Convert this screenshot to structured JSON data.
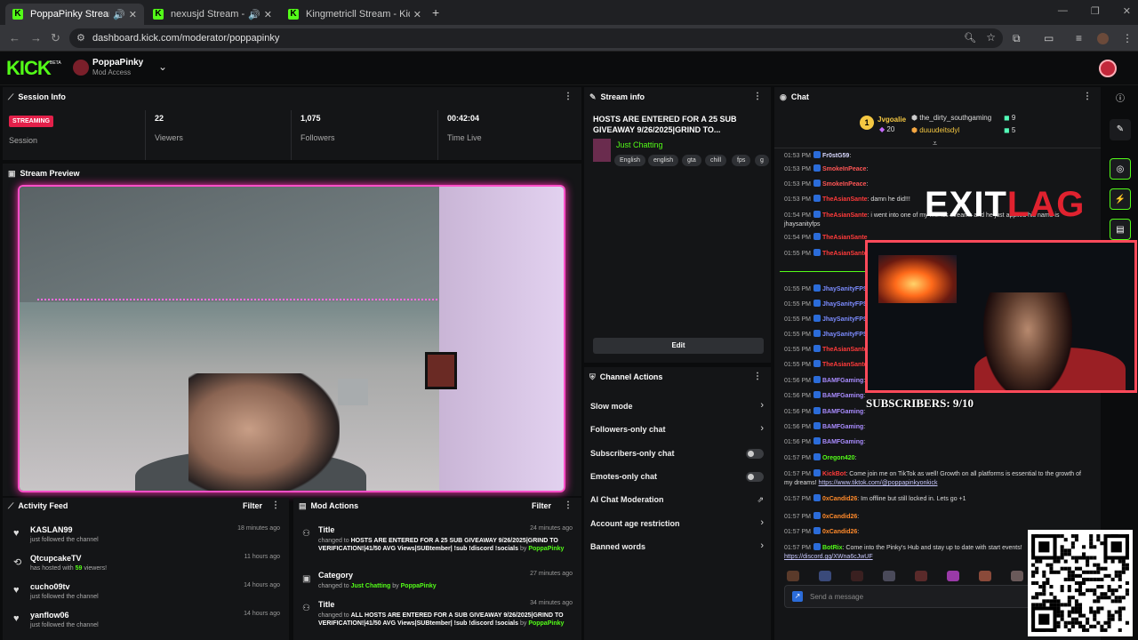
{
  "browser": {
    "tabs": [
      {
        "title": "PoppaPinky Stream - Kick D",
        "active": true
      },
      {
        "title": "nexusjd Stream - Kick Dash",
        "active": false
      },
      {
        "title": "Kingmetricll Stream - Kick Dash",
        "active": false
      }
    ],
    "url": "dashboard.kick.com/moderator/poppapinky"
  },
  "header": {
    "logo": "KICK",
    "logo_badge": "BETA",
    "channel_name": "PoppaPinky",
    "channel_role": "Mod Access"
  },
  "session": {
    "title": "Session Info",
    "badge": "STREAMING",
    "session_label": "Session",
    "viewers": "22",
    "viewers_label": "Viewers",
    "followers": "1,075",
    "followers_label": "Followers",
    "time_live": "00:42:04",
    "time_live_label": "Time Live"
  },
  "preview": {
    "title": "Stream Preview"
  },
  "stream_info": {
    "title": "Stream info",
    "stream_title": "HOSTS ARE ENTERED FOR A 25 SUB GIVEAWAY 9/26/2025|GRIND TO...",
    "category": "Just Chatting",
    "tags": [
      "English",
      "english",
      "gta",
      "chill",
      "fps",
      "g"
    ],
    "edit_label": "Edit"
  },
  "channel_actions": {
    "title": "Channel Actions",
    "items": [
      {
        "label": "Slow mode",
        "control": "chevron"
      },
      {
        "label": "Followers-only chat",
        "control": "chevron"
      },
      {
        "label": "Subscribers-only chat",
        "control": "toggle"
      },
      {
        "label": "Emotes-only chat",
        "control": "toggle"
      },
      {
        "label": "AI Chat Moderation",
        "control": "external"
      },
      {
        "label": "Account age restriction",
        "control": "chevron"
      },
      {
        "label": "Banned words",
        "control": "chevron"
      }
    ]
  },
  "activity": {
    "title": "Activity Feed",
    "filter_label": "Filter",
    "items": [
      {
        "name": "KASLAN99",
        "desc": "just followed the channel",
        "time": "18 minutes ago",
        "icon": "heart-icon"
      },
      {
        "name": "QtcupcakeTV",
        "desc_pre": "has hosted with ",
        "desc_count": "59",
        "desc_post": " viewers!",
        "time": "11 hours ago",
        "icon": "host-icon"
      },
      {
        "name": "cucho09tv",
        "desc": "just followed the channel",
        "time": "14 hours ago",
        "icon": "heart-icon"
      },
      {
        "name": "yanflow06",
        "desc": "just followed the channel",
        "time": "14 hours ago",
        "icon": "heart-icon"
      }
    ]
  },
  "mod_actions": {
    "title": "Mod Actions",
    "filter_label": "Filter",
    "items": [
      {
        "title": "Title",
        "time": "24 minutes ago",
        "pre": "changed to ",
        "value": "HOSTS ARE ENTERED FOR A 25 SUB GIVEAWAY 9/26/2025|GRIND TO VERIFICATION!|41/50 AVG Views|SUBtember| !sub !discord !socials",
        "by": " by ",
        "user": "PoppaPinky"
      },
      {
        "title": "Category",
        "time": "27 minutes ago",
        "pre": "changed to ",
        "value": "Just Chatting",
        "by": " by ",
        "user": "PoppaPinky"
      },
      {
        "title": "Title",
        "time": "34 minutes ago",
        "pre": "changed to ",
        "value": "ALL HOSTS ARE ENTERED FOR A SUB GIVEAWAY 9/26/2025|GRIND TO VERIFICATION!|41/50 AVG Views|SUBtember| !sub !discord !socials",
        "by": " by ",
        "user": "PoppaPinky"
      }
    ]
  },
  "chat": {
    "title": "Chat",
    "top_gifters": [
      {
        "rank": "1",
        "name": "Jvgoalie",
        "count": "20",
        "color": "#f5c842"
      },
      {
        "name": "the_dirty_southgaming",
        "count": "9",
        "color": "#cccccc"
      },
      {
        "name": "duuudeitsdyl",
        "count": "5",
        "color": "#f5a742"
      }
    ],
    "messages": [
      {
        "time": "01:53 PM",
        "user": "Fr0stG59",
        "color": "#d9d9ff",
        "text": ":"
      },
      {
        "time": "01:53 PM",
        "user": "SmokeInPeace",
        "color": "#ff5555",
        "text": ":"
      },
      {
        "time": "01:53 PM",
        "user": "SmokeInPeace",
        "color": "#ff5555",
        "text": ":"
      },
      {
        "time": "01:53 PM",
        "user": "TheAsianSante",
        "color": "#ff3b3b",
        "text": ": damn he did!!!"
      },
      {
        "time": "01:54 PM",
        "user": "TheAsianSante",
        "color": "#ff3b3b",
        "text": ": i went into one of my friends streams and he just applied his name is jhaysanityfps"
      },
      {
        "time": "01:54 PM",
        "user": "TheAsianSante",
        "color": "#ff3b3b",
        "text": ""
      },
      {
        "time": "01:55 PM",
        "user": "TheAsianSante",
        "color": "#ff3b3b",
        "text": ""
      },
      {
        "time": "01:55 PM",
        "user": "JhaySanityFPS",
        "color": "#7c8cff",
        "text": ":"
      },
      {
        "time": "01:55 PM",
        "user": "JhaySanityFPS",
        "color": "#7c8cff",
        "text": ""
      },
      {
        "time": "01:55 PM",
        "user": "JhaySanityFPS",
        "color": "#7c8cff",
        "text": ""
      },
      {
        "time": "01:55 PM",
        "user": "JhaySanityFPS",
        "color": "#7c8cff",
        "text": ""
      },
      {
        "time": "01:55 PM",
        "user": "TheAsianSante",
        "color": "#ff3b3b",
        "text": ""
      },
      {
        "time": "01:55 PM",
        "user": "TheAsianSante",
        "color": "#ff3b3b",
        "text": ""
      },
      {
        "time": "01:56 PM",
        "user": "BAMFGaming",
        "color": "#a98cff",
        "text": ":"
      },
      {
        "time": "01:56 PM",
        "user": "BAMFGaming",
        "color": "#a98cff",
        "text": ":"
      },
      {
        "time": "01:56 PM",
        "user": "BAMFGaming",
        "color": "#a98cff",
        "text": ":"
      },
      {
        "time": "01:56 PM",
        "user": "BAMFGaming",
        "color": "#a98cff",
        "text": ":"
      },
      {
        "time": "01:56 PM",
        "user": "BAMFGaming",
        "color": "#a98cff",
        "text": ":"
      },
      {
        "time": "01:57 PM",
        "user": "Oregon420",
        "color": "#53fc18",
        "text": ":"
      },
      {
        "time": "01:57 PM",
        "user": "KickBot",
        "color": "#ff3b3b",
        "text": ": Come join me on TikTok as well! Growth on all platforms is essential to the growth of my dreams! ",
        "link": "https://www.tiktok.com/@poppapinkyonkick"
      },
      {
        "time": "01:57 PM",
        "user": "0xCandid26",
        "color": "#ff8a2b",
        "text": ": Im offline but still locked in. Lets go +1"
      },
      {
        "time": "01:57 PM",
        "user": "0xCandid26",
        "color": "#ff8a2b",
        "text": ":"
      },
      {
        "time": "01:57 PM",
        "user": "0xCandid26",
        "color": "#ff8a2b",
        "text": ":"
      },
      {
        "time": "01:57 PM",
        "user": "BotRix",
        "color": "#53fc18",
        "text": ": Come into the Pinky's Hub and stay up to date with start events! ",
        "link": "https://discord.gg/XWna6cJwUF"
      }
    ],
    "input_placeholder": "Send a message"
  },
  "overlay": {
    "logo_white": "EXIT",
    "logo_red": "LAG",
    "subscribers": "SUBSCRIBERS: 9/10"
  }
}
